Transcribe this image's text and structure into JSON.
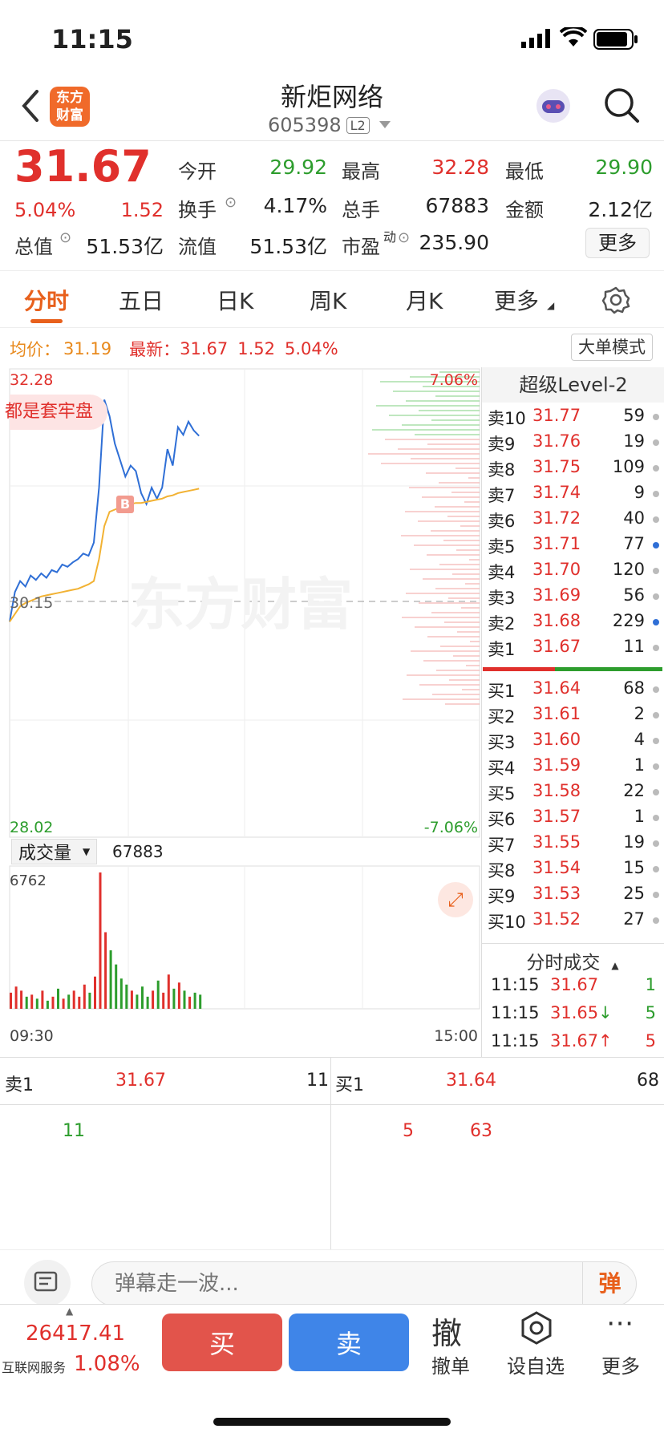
{
  "status": {
    "time": "11:15"
  },
  "nav": {
    "title": "新炬网络",
    "code": "605398",
    "level_badge": "L2",
    "logo_text_1": "东方",
    "logo_text_2": "财富"
  },
  "quote": {
    "price": "31.67",
    "change_pct": "5.04%",
    "change": "1.52",
    "open_label": "今开",
    "open": "29.92",
    "high_label": "最高",
    "high": "32.28",
    "low_label": "最低",
    "low": "29.90",
    "turnover_label": "换手",
    "turnover": "4.17%",
    "volume_label": "总手",
    "volume": "67883",
    "amount_label": "金额",
    "amount": "2.12亿",
    "mktcap_label": "总值",
    "mktcap": "51.53亿",
    "float_label": "流值",
    "float": "51.53亿",
    "pe_label": "市盈",
    "pe_sup": "动",
    "pe": "235.90",
    "more_button": "更多"
  },
  "tabs": [
    "分时",
    "五日",
    "日K",
    "周K",
    "月K",
    "更多"
  ],
  "chart_header": {
    "avg_label": "均价：",
    "avg": "31.19",
    "latest_label": "最新：",
    "latest": "31.67",
    "change": "1.52",
    "change_pct": "5.04%",
    "big_order_button": "大单模式"
  },
  "chart_data": {
    "type": "line",
    "y_top": "32.28",
    "y_bottom": "28.02",
    "pct_top": "7.06%",
    "pct_bottom": "-7.06%",
    "prev_close": "30.15",
    "x_start": "09:30",
    "x_end": "15:00",
    "ylim": [
      28.02,
      32.28
    ],
    "series": [
      {
        "name": "price",
        "values": [
          29.98,
          30.25,
          30.35,
          30.3,
          30.4,
          30.36,
          30.42,
          30.38,
          30.45,
          30.43,
          30.5,
          30.48,
          30.52,
          30.55,
          30.6,
          30.58,
          30.7,
          31.2,
          32.0,
          31.85,
          31.6,
          31.45,
          31.3,
          31.4,
          31.35,
          31.15,
          31.05,
          31.2,
          31.1,
          31.2,
          31.55,
          31.4,
          31.75,
          31.68,
          31.8,
          31.72,
          31.67
        ]
      },
      {
        "name": "avg",
        "values": [
          29.98,
          30.05,
          30.12,
          30.15,
          30.17,
          30.19,
          30.21,
          30.22,
          30.23,
          30.24,
          30.25,
          30.26,
          30.27,
          30.28,
          30.3,
          30.32,
          30.35,
          30.55,
          30.85,
          30.98,
          31.0,
          31.02,
          31.03,
          31.05,
          31.06,
          31.06,
          31.07,
          31.08,
          31.09,
          31.1,
          31.12,
          31.13,
          31.15,
          31.16,
          31.17,
          31.18,
          31.19
        ]
      }
    ],
    "volume_label": "成交量",
    "volume_total": "67883",
    "volume_max": "6762",
    "volume_values": [
      800,
      1100,
      900,
      600,
      700,
      500,
      900,
      400,
      600,
      1000,
      500,
      700,
      900,
      600,
      1200,
      800,
      1600,
      6762,
      3800,
      2900,
      2200,
      1500,
      1200,
      900,
      700,
      1100,
      600,
      900,
      1400,
      800,
      1700,
      1000,
      1300,
      900,
      600,
      800,
      700
    ]
  },
  "badge_b": "B",
  "banner": "都是套牢盘",
  "watermark": "东方财富",
  "orderbook": {
    "title": "超级Level-2",
    "asks": [
      {
        "label": "卖10",
        "price": "31.77",
        "qty": "59",
        "dot": "gray"
      },
      {
        "label": "卖9",
        "price": "31.76",
        "qty": "19",
        "dot": "gray"
      },
      {
        "label": "卖8",
        "price": "31.75",
        "qty": "109",
        "dot": "gray"
      },
      {
        "label": "卖7",
        "price": "31.74",
        "qty": "9",
        "dot": "gray"
      },
      {
        "label": "卖6",
        "price": "31.72",
        "qty": "40",
        "dot": "gray"
      },
      {
        "label": "卖5",
        "price": "31.71",
        "qty": "77",
        "dot": "blue"
      },
      {
        "label": "卖4",
        "price": "31.70",
        "qty": "120",
        "dot": "gray"
      },
      {
        "label": "卖3",
        "price": "31.69",
        "qty": "56",
        "dot": "gray"
      },
      {
        "label": "卖2",
        "price": "31.68",
        "qty": "229",
        "dot": "blue"
      },
      {
        "label": "卖1",
        "price": "31.67",
        "qty": "11",
        "dot": "gray"
      }
    ],
    "bids": [
      {
        "label": "买1",
        "price": "31.64",
        "qty": "68",
        "dot": "gray"
      },
      {
        "label": "买2",
        "price": "31.61",
        "qty": "2",
        "dot": "gray"
      },
      {
        "label": "买3",
        "price": "31.60",
        "qty": "4",
        "dot": "gray"
      },
      {
        "label": "买4",
        "price": "31.59",
        "qty": "1",
        "dot": "gray"
      },
      {
        "label": "买5",
        "price": "31.58",
        "qty": "22",
        "dot": "gray"
      },
      {
        "label": "买6",
        "price": "31.57",
        "qty": "1",
        "dot": "gray"
      },
      {
        "label": "买7",
        "price": "31.55",
        "qty": "19",
        "dot": "gray"
      },
      {
        "label": "买8",
        "price": "31.54",
        "qty": "15",
        "dot": "gray"
      },
      {
        "label": "买9",
        "price": "31.53",
        "qty": "25",
        "dot": "gray"
      },
      {
        "label": "买10",
        "price": "31.52",
        "qty": "27",
        "dot": "gray"
      }
    ],
    "trades_title": "分时成交",
    "trades": [
      {
        "time": "11:15",
        "price": "31.67",
        "arrow": "",
        "qty": "1",
        "color": "green"
      },
      {
        "time": "11:15",
        "price": "31.65",
        "arrow": "↓",
        "qty": "5",
        "color": "green"
      },
      {
        "time": "11:15",
        "price": "31.67",
        "arrow": "↑",
        "qty": "5",
        "color": "red"
      }
    ]
  },
  "queue": {
    "ask_label": "卖1",
    "ask_price": "31.67",
    "ask_qty": "11",
    "bid_label": "买1",
    "bid_price": "31.64",
    "bid_qty": "68",
    "ask_orders": [
      "11"
    ],
    "bid_orders": [
      "5",
      "63"
    ]
  },
  "comment": {
    "placeholder": "弹幕走一波...",
    "danmu_button": "弹"
  },
  "bottom": {
    "index_value": "26417.41",
    "index_name": "互联网服务",
    "index_pct": "1.08%",
    "buy": "买",
    "sell": "卖",
    "cancel_icon": "撤",
    "cancel": "撤单",
    "watch": "设自选",
    "more": "更多"
  }
}
